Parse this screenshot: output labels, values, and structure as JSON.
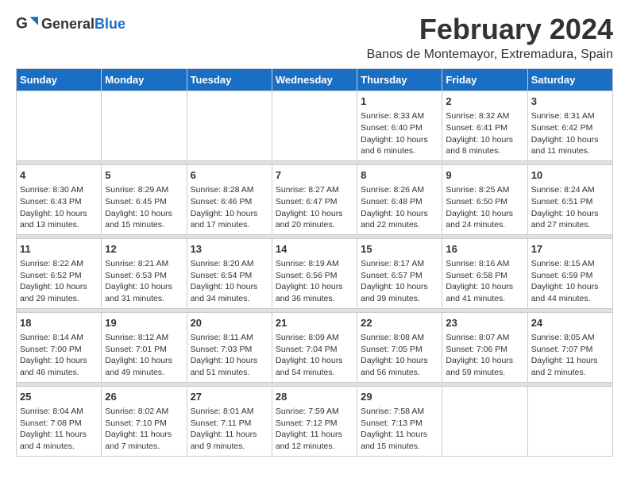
{
  "logo": {
    "text_general": "General",
    "text_blue": "Blue"
  },
  "title": "February 2024",
  "subtitle": "Banos de Montemayor, Extremadura, Spain",
  "days_of_week": [
    "Sunday",
    "Monday",
    "Tuesday",
    "Wednesday",
    "Thursday",
    "Friday",
    "Saturday"
  ],
  "weeks": [
    [
      {
        "day": "",
        "content": ""
      },
      {
        "day": "",
        "content": ""
      },
      {
        "day": "",
        "content": ""
      },
      {
        "day": "",
        "content": ""
      },
      {
        "day": "1",
        "content": "Sunrise: 8:33 AM\nSunset: 6:40 PM\nDaylight: 10 hours and 6 minutes."
      },
      {
        "day": "2",
        "content": "Sunrise: 8:32 AM\nSunset: 6:41 PM\nDaylight: 10 hours and 8 minutes."
      },
      {
        "day": "3",
        "content": "Sunrise: 8:31 AM\nSunset: 6:42 PM\nDaylight: 10 hours and 11 minutes."
      }
    ],
    [
      {
        "day": "4",
        "content": "Sunrise: 8:30 AM\nSunset: 6:43 PM\nDaylight: 10 hours and 13 minutes."
      },
      {
        "day": "5",
        "content": "Sunrise: 8:29 AM\nSunset: 6:45 PM\nDaylight: 10 hours and 15 minutes."
      },
      {
        "day": "6",
        "content": "Sunrise: 8:28 AM\nSunset: 6:46 PM\nDaylight: 10 hours and 17 minutes."
      },
      {
        "day": "7",
        "content": "Sunrise: 8:27 AM\nSunset: 6:47 PM\nDaylight: 10 hours and 20 minutes."
      },
      {
        "day": "8",
        "content": "Sunrise: 8:26 AM\nSunset: 6:48 PM\nDaylight: 10 hours and 22 minutes."
      },
      {
        "day": "9",
        "content": "Sunrise: 8:25 AM\nSunset: 6:50 PM\nDaylight: 10 hours and 24 minutes."
      },
      {
        "day": "10",
        "content": "Sunrise: 8:24 AM\nSunset: 6:51 PM\nDaylight: 10 hours and 27 minutes."
      }
    ],
    [
      {
        "day": "11",
        "content": "Sunrise: 8:22 AM\nSunset: 6:52 PM\nDaylight: 10 hours and 29 minutes."
      },
      {
        "day": "12",
        "content": "Sunrise: 8:21 AM\nSunset: 6:53 PM\nDaylight: 10 hours and 31 minutes."
      },
      {
        "day": "13",
        "content": "Sunrise: 8:20 AM\nSunset: 6:54 PM\nDaylight: 10 hours and 34 minutes."
      },
      {
        "day": "14",
        "content": "Sunrise: 8:19 AM\nSunset: 6:56 PM\nDaylight: 10 hours and 36 minutes."
      },
      {
        "day": "15",
        "content": "Sunrise: 8:17 AM\nSunset: 6:57 PM\nDaylight: 10 hours and 39 minutes."
      },
      {
        "day": "16",
        "content": "Sunrise: 8:16 AM\nSunset: 6:58 PM\nDaylight: 10 hours and 41 minutes."
      },
      {
        "day": "17",
        "content": "Sunrise: 8:15 AM\nSunset: 6:59 PM\nDaylight: 10 hours and 44 minutes."
      }
    ],
    [
      {
        "day": "18",
        "content": "Sunrise: 8:14 AM\nSunset: 7:00 PM\nDaylight: 10 hours and 46 minutes."
      },
      {
        "day": "19",
        "content": "Sunrise: 8:12 AM\nSunset: 7:01 PM\nDaylight: 10 hours and 49 minutes."
      },
      {
        "day": "20",
        "content": "Sunrise: 8:11 AM\nSunset: 7:03 PM\nDaylight: 10 hours and 51 minutes."
      },
      {
        "day": "21",
        "content": "Sunrise: 8:09 AM\nSunset: 7:04 PM\nDaylight: 10 hours and 54 minutes."
      },
      {
        "day": "22",
        "content": "Sunrise: 8:08 AM\nSunset: 7:05 PM\nDaylight: 10 hours and 56 minutes."
      },
      {
        "day": "23",
        "content": "Sunrise: 8:07 AM\nSunset: 7:06 PM\nDaylight: 10 hours and 59 minutes."
      },
      {
        "day": "24",
        "content": "Sunrise: 8:05 AM\nSunset: 7:07 PM\nDaylight: 11 hours and 2 minutes."
      }
    ],
    [
      {
        "day": "25",
        "content": "Sunrise: 8:04 AM\nSunset: 7:08 PM\nDaylight: 11 hours and 4 minutes."
      },
      {
        "day": "26",
        "content": "Sunrise: 8:02 AM\nSunset: 7:10 PM\nDaylight: 11 hours and 7 minutes."
      },
      {
        "day": "27",
        "content": "Sunrise: 8:01 AM\nSunset: 7:11 PM\nDaylight: 11 hours and 9 minutes."
      },
      {
        "day": "28",
        "content": "Sunrise: 7:59 AM\nSunset: 7:12 PM\nDaylight: 11 hours and 12 minutes."
      },
      {
        "day": "29",
        "content": "Sunrise: 7:58 AM\nSunset: 7:13 PM\nDaylight: 11 hours and 15 minutes."
      },
      {
        "day": "",
        "content": ""
      },
      {
        "day": "",
        "content": ""
      }
    ]
  ]
}
